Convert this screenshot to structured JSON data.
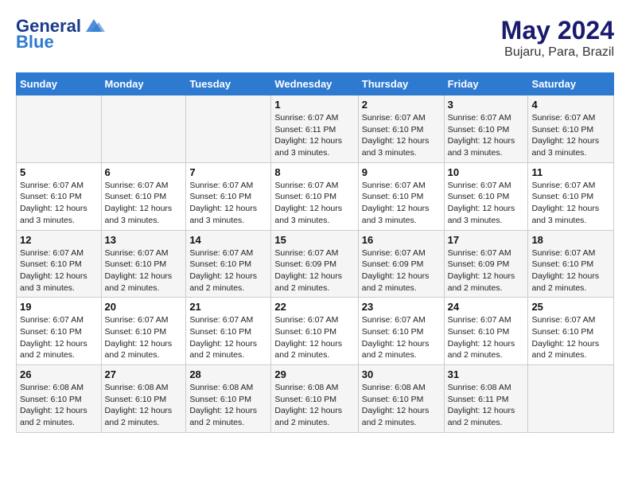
{
  "header": {
    "logo_general": "General",
    "logo_blue": "Blue",
    "month_year": "May 2024",
    "location": "Bujaru, Para, Brazil"
  },
  "days_of_week": [
    "Sunday",
    "Monday",
    "Tuesday",
    "Wednesday",
    "Thursday",
    "Friday",
    "Saturday"
  ],
  "weeks": [
    [
      {
        "day": "",
        "info": ""
      },
      {
        "day": "",
        "info": ""
      },
      {
        "day": "",
        "info": ""
      },
      {
        "day": "1",
        "info": "Sunrise: 6:07 AM\nSunset: 6:11 PM\nDaylight: 12 hours\nand 3 minutes."
      },
      {
        "day": "2",
        "info": "Sunrise: 6:07 AM\nSunset: 6:10 PM\nDaylight: 12 hours\nand 3 minutes."
      },
      {
        "day": "3",
        "info": "Sunrise: 6:07 AM\nSunset: 6:10 PM\nDaylight: 12 hours\nand 3 minutes."
      },
      {
        "day": "4",
        "info": "Sunrise: 6:07 AM\nSunset: 6:10 PM\nDaylight: 12 hours\nand 3 minutes."
      }
    ],
    [
      {
        "day": "5",
        "info": "Sunrise: 6:07 AM\nSunset: 6:10 PM\nDaylight: 12 hours\nand 3 minutes."
      },
      {
        "day": "6",
        "info": "Sunrise: 6:07 AM\nSunset: 6:10 PM\nDaylight: 12 hours\nand 3 minutes."
      },
      {
        "day": "7",
        "info": "Sunrise: 6:07 AM\nSunset: 6:10 PM\nDaylight: 12 hours\nand 3 minutes."
      },
      {
        "day": "8",
        "info": "Sunrise: 6:07 AM\nSunset: 6:10 PM\nDaylight: 12 hours\nand 3 minutes."
      },
      {
        "day": "9",
        "info": "Sunrise: 6:07 AM\nSunset: 6:10 PM\nDaylight: 12 hours\nand 3 minutes."
      },
      {
        "day": "10",
        "info": "Sunrise: 6:07 AM\nSunset: 6:10 PM\nDaylight: 12 hours\nand 3 minutes."
      },
      {
        "day": "11",
        "info": "Sunrise: 6:07 AM\nSunset: 6:10 PM\nDaylight: 12 hours\nand 3 minutes."
      }
    ],
    [
      {
        "day": "12",
        "info": "Sunrise: 6:07 AM\nSunset: 6:10 PM\nDaylight: 12 hours\nand 3 minutes."
      },
      {
        "day": "13",
        "info": "Sunrise: 6:07 AM\nSunset: 6:10 PM\nDaylight: 12 hours\nand 2 minutes."
      },
      {
        "day": "14",
        "info": "Sunrise: 6:07 AM\nSunset: 6:10 PM\nDaylight: 12 hours\nand 2 minutes."
      },
      {
        "day": "15",
        "info": "Sunrise: 6:07 AM\nSunset: 6:09 PM\nDaylight: 12 hours\nand 2 minutes."
      },
      {
        "day": "16",
        "info": "Sunrise: 6:07 AM\nSunset: 6:09 PM\nDaylight: 12 hours\nand 2 minutes."
      },
      {
        "day": "17",
        "info": "Sunrise: 6:07 AM\nSunset: 6:09 PM\nDaylight: 12 hours\nand 2 minutes."
      },
      {
        "day": "18",
        "info": "Sunrise: 6:07 AM\nSunset: 6:10 PM\nDaylight: 12 hours\nand 2 minutes."
      }
    ],
    [
      {
        "day": "19",
        "info": "Sunrise: 6:07 AM\nSunset: 6:10 PM\nDaylight: 12 hours\nand 2 minutes."
      },
      {
        "day": "20",
        "info": "Sunrise: 6:07 AM\nSunset: 6:10 PM\nDaylight: 12 hours\nand 2 minutes."
      },
      {
        "day": "21",
        "info": "Sunrise: 6:07 AM\nSunset: 6:10 PM\nDaylight: 12 hours\nand 2 minutes."
      },
      {
        "day": "22",
        "info": "Sunrise: 6:07 AM\nSunset: 6:10 PM\nDaylight: 12 hours\nand 2 minutes."
      },
      {
        "day": "23",
        "info": "Sunrise: 6:07 AM\nSunset: 6:10 PM\nDaylight: 12 hours\nand 2 minutes."
      },
      {
        "day": "24",
        "info": "Sunrise: 6:07 AM\nSunset: 6:10 PM\nDaylight: 12 hours\nand 2 minutes."
      },
      {
        "day": "25",
        "info": "Sunrise: 6:07 AM\nSunset: 6:10 PM\nDaylight: 12 hours\nand 2 minutes."
      }
    ],
    [
      {
        "day": "26",
        "info": "Sunrise: 6:08 AM\nSunset: 6:10 PM\nDaylight: 12 hours\nand 2 minutes."
      },
      {
        "day": "27",
        "info": "Sunrise: 6:08 AM\nSunset: 6:10 PM\nDaylight: 12 hours\nand 2 minutes."
      },
      {
        "day": "28",
        "info": "Sunrise: 6:08 AM\nSunset: 6:10 PM\nDaylight: 12 hours\nand 2 minutes."
      },
      {
        "day": "29",
        "info": "Sunrise: 6:08 AM\nSunset: 6:10 PM\nDaylight: 12 hours\nand 2 minutes."
      },
      {
        "day": "30",
        "info": "Sunrise: 6:08 AM\nSunset: 6:10 PM\nDaylight: 12 hours\nand 2 minutes."
      },
      {
        "day": "31",
        "info": "Sunrise: 6:08 AM\nSunset: 6:11 PM\nDaylight: 12 hours\nand 2 minutes."
      },
      {
        "day": "",
        "info": ""
      }
    ]
  ]
}
